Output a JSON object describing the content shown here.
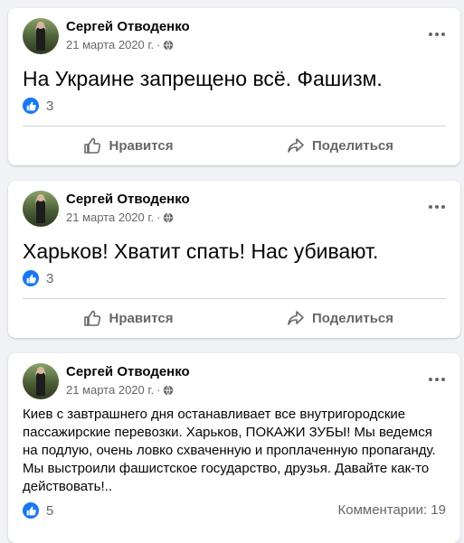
{
  "posts": [
    {
      "author": "Сергей Отводенко",
      "date": "21 марта 2020 г.",
      "separator": "·",
      "text": "На Украине запрещено всё. Фашизм.",
      "likes": "3",
      "actions": {
        "like": "Нравится",
        "share": "Поделиться"
      }
    },
    {
      "author": "Сергей Отводенко",
      "date": "21 марта 2020 г.",
      "separator": "·",
      "text": "Харьков! Хватит спать! Нас убивают.",
      "likes": "3",
      "actions": {
        "like": "Нравится",
        "share": "Поделиться"
      }
    },
    {
      "author": "Сергей Отводенко",
      "date": "21 марта 2020 г.",
      "separator": "·",
      "text": "Киев с завтрашнего дня останавливает все внутригородские пассажирские перевозки. Харьков, ПОКАЖИ ЗУБЫ! Мы ведемся на подлую, очень ловко схваченную и проплаченную пропаганду. Мы выстроили фашистское государство, друзья. Давайте как-то действовать!..",
      "likes": "5",
      "comments": "Комментарии: 19"
    }
  ],
  "colors": {
    "background": "#f0f2f5",
    "card": "#ffffff",
    "accent": "#1877f2",
    "secondary_text": "#65676b",
    "divider": "#ced0d4"
  },
  "icons": {
    "privacy": "globe-icon",
    "more": "more-options-icon",
    "reaction": "like-reaction-icon",
    "like_action": "thumbs-up-icon",
    "share_action": "share-arrow-icon"
  }
}
